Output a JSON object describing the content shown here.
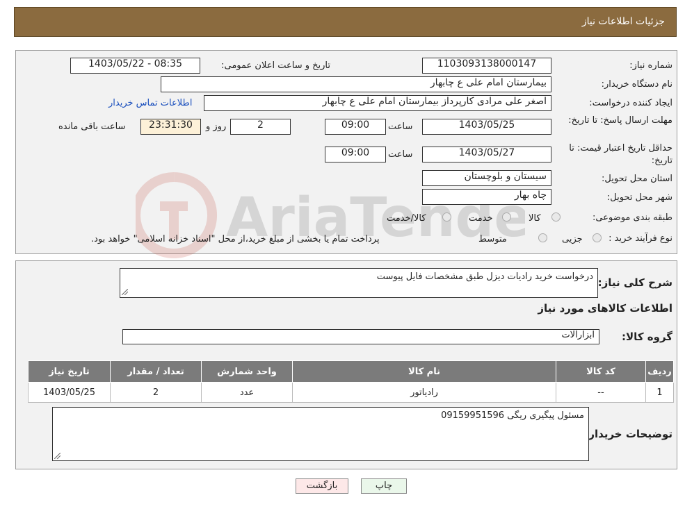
{
  "header": {
    "title": "جزئیات اطلاعات نیاز"
  },
  "form": {
    "need_number_label": "شماره نیاز:",
    "need_number": "1103093138000147",
    "announce_label": "تاریخ و ساعت اعلان عمومی:",
    "announce_value": "1403/05/22 - 08:35",
    "buyer_org_label": "نام دستگاه خریدار:",
    "buyer_org": "بیمارستان امام علی  ع  چابهار",
    "requester_label": "ایجاد کننده درخواست:",
    "requester": "اصغر علی مرادی کارپرداز بیمارستان امام علی  ع  چابهار",
    "contact_link": "اطلاعات تماس خریدار",
    "reply_deadline_label": "مهلت ارسال پاسخ: تا تاریخ:",
    "reply_date": "1403/05/25",
    "time_label": "ساعت",
    "reply_time": "09:00",
    "days_value": "2",
    "days_label": "روز و",
    "remaining_time": "23:31:30",
    "remaining_label": "ساعت باقی مانده",
    "price_validity_label": "حداقل تاریخ اعتبار قیمت: تا تاریخ:",
    "price_date": "1403/05/27",
    "price_time": "09:00",
    "province_label": "استان محل تحویل:",
    "province": "سیستان و بلوچستان",
    "city_label": "شهر محل تحویل:",
    "city": "چاه بهار",
    "category_label": "طبقه بندی موضوعی:",
    "category_options": [
      "کالا",
      "خدمت",
      "کالا/خدمت"
    ],
    "process_label": "نوع فرآیند خرید :",
    "process_options": [
      "جزیی",
      "متوسط"
    ],
    "process_note": "پرداخت تمام یا بخشی از مبلغ خرید،از محل \"اسناد خزانه اسلامی\" خواهد بود."
  },
  "details": {
    "summary_label": "شرح کلی نیاز:",
    "summary": "درخواست خرید رادیات دیزل طبق مشخصات فایل پیوست",
    "goods_info_title": "اطلاعات کالاهای مورد نیاز",
    "goods_group_label": "گروه کالا:",
    "goods_group": "ابزارآلات",
    "table": {
      "headers": [
        "ردیف",
        "کد کالا",
        "نام کالا",
        "واحد شمارش",
        "تعداد / مقدار",
        "تاریخ نیاز"
      ],
      "rows": [
        [
          "1",
          "--",
          "رادیاتور",
          "عدد",
          "2",
          "1403/05/25"
        ]
      ]
    },
    "buyer_notes_label": "توضیحات خریدار:",
    "buyer_notes": "مسئول پیگیری ریگی 09159951596"
  },
  "buttons": {
    "print": "چاپ",
    "back": "بازگشت"
  },
  "watermark": "AriaTender.neT"
}
